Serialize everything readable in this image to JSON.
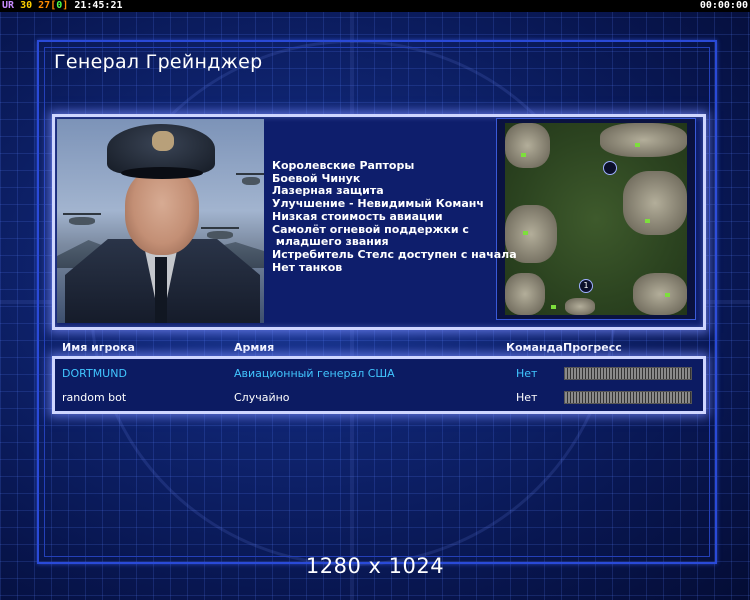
{
  "statusbar": {
    "ur": "UR",
    "fps": "30",
    "count": "27",
    "bracket_open": "[",
    "bracket_value": "0",
    "bracket_close": "]",
    "clock": "21:45:21",
    "timer": "00:00:00"
  },
  "title": "Генерал Грейнджер",
  "features": [
    "Королевские Рапторы",
    "Боевой Чинук",
    "Лазерная защита",
    "Улучшение - Невидимый Команч",
    "Низкая стоимость авиации",
    "Самолёт огневой поддержки с",
    " младшего звания",
    "Истребитель Стелс доступен с начала",
    "Нет танков"
  ],
  "minimap": {
    "start_marker_1": "1"
  },
  "players_table": {
    "headers": {
      "player": "Имя игрока",
      "army": "Армия",
      "team": "Команда",
      "progress": "Прогресс"
    },
    "rows": [
      {
        "name": "DORTMUND",
        "army": "Авиационный генерал США",
        "team": "Нет",
        "progress": 1.0
      },
      {
        "name": "random bot",
        "army": "Случайно",
        "team": "Нет",
        "progress": 1.0
      }
    ]
  },
  "resolution": "1280 x 1024",
  "colors": {
    "player_highlight": "#41c6ff",
    "panel_glow": "#cfd6ff",
    "background": "#0f2470"
  }
}
